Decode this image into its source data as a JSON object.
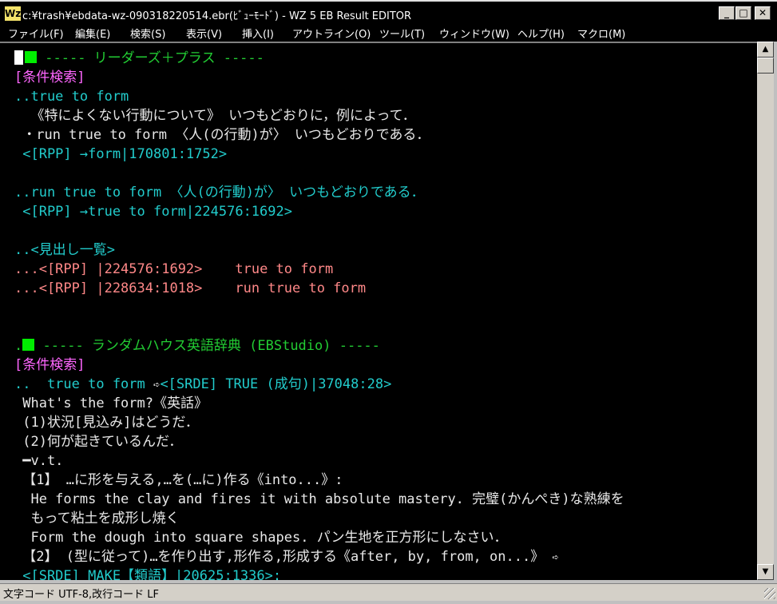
{
  "window": {
    "title": "c:¥trash¥ebdata-wz-090318220514.ebr(ﾋﾞｭｰﾓｰﾄﾞ) - WZ 5 EB Result EDITOR",
    "icon_text": "Wz",
    "buttons": {
      "minimize": "_",
      "maximize": "□",
      "close": "✕"
    }
  },
  "menu": [
    "ファイル(F)",
    "編集(E)",
    "検索(S)",
    "表示(V)",
    "挿入(I)",
    "アウトライン(O)",
    "ツール(T)",
    "ウィンドウ(W)",
    "ヘルプ(H)",
    "マクロ(M)"
  ],
  "editor": {
    "l1": "----- リーダーズ＋プラス -----",
    "l2": "[条件検索]",
    "l3": "..true to form",
    "l4": "  《特によくない行動について》 いつもどおりに，例によって．",
    "l5": " ・run true to form 〈人(の行動)が〉 いつもどおりである．",
    "l6": " <[RPP] →form|170801:1752>",
    "l8": "..run true to form 〈人(の行動)が〉 いつもどおりである．",
    "l9": " <[RPP] →true to form|224576:1692>",
    "l11": "..<見出し一覧>",
    "l12a": "...<[RPP] |224576:1692>",
    "l12b": "true to form",
    "l13a": "...<[RPP] |228634:1018>",
    "l13b": "run true to form",
    "l15": "----- ランダムハウス英語辞典 (EBStudio) -----",
    "l16": "[条件検索]",
    "l17a": "..  true to form ",
    "l17b": "<[SRDE] TRUE (成句)|37048:28>",
    "l18": " What's the form?《英話》",
    "l19": " (1)状況[見込み]はどうだ．",
    "l20": " (2)何が起きているんだ．",
    "l21": " ━v.t.",
    "l22": " 【1】 …に形を与える,…を(…に)作る《into...》:",
    "l23": "  He forms the clay and fires it with absolute mastery. 完璧(かんぺき)な熟練を",
    "l24": "  もって粘土を成形し焼く",
    "l25": "  Form the dough into square shapes. パン生地を正方形にしなさい．",
    "l26": " 【2】 (型に従って)…を作り出す,形作る,形成する《after, by, from, on...》 ",
    "l27": " <[SRDE] MAKE【類語】|20625:1336>:"
  },
  "status": "文字コード UTF-8,改行コード LF"
}
